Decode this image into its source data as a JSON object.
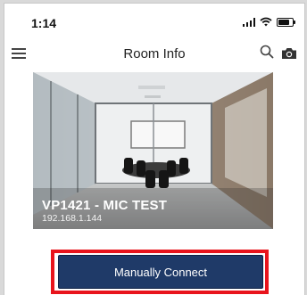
{
  "status_bar": {
    "time": "1:14",
    "icons": [
      "signal-icon",
      "wifi-icon",
      "battery-icon"
    ]
  },
  "nav": {
    "title": "Room Info",
    "menu_icon": "hamburger-menu-icon",
    "search_icon": "search-icon",
    "camera_icon": "camera-icon"
  },
  "room": {
    "name": "VP1421 - MIC TEST",
    "ip": "192.168.1.144"
  },
  "actions": {
    "connect_label": "Manually Connect"
  },
  "colors": {
    "button": "#1f3a68",
    "highlight": "#e8141c"
  }
}
